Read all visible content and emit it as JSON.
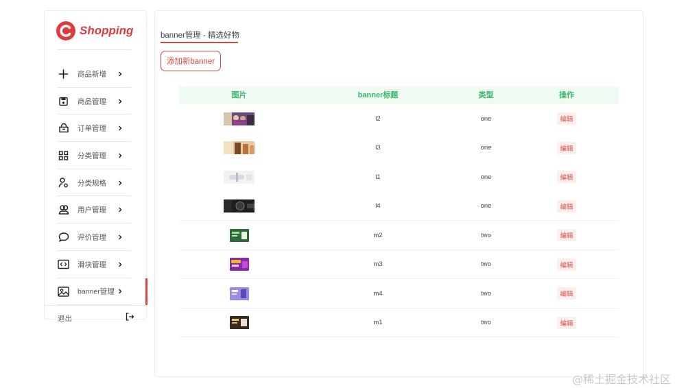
{
  "app": {
    "brand": "Shopping",
    "brand_mark": "C",
    "accent": "#e03a3e"
  },
  "sidebar": {
    "items": [
      {
        "label": "商品新增",
        "icon": "plus-icon",
        "active": false
      },
      {
        "label": "商品管理",
        "icon": "save-icon",
        "active": false
      },
      {
        "label": "订单管理",
        "icon": "shopping-bag-icon",
        "active": false
      },
      {
        "label": "分类管理",
        "icon": "grid-icon",
        "active": false
      },
      {
        "label": "分类规格",
        "icon": "user-location-icon",
        "active": false
      },
      {
        "label": "用户管理",
        "icon": "users-icon",
        "active": false
      },
      {
        "label": "评价管理",
        "icon": "comment-icon",
        "active": false
      },
      {
        "label": "滑块管理",
        "icon": "code-icon",
        "active": false
      },
      {
        "label": "banner管理",
        "icon": "image-icon",
        "active": true
      }
    ],
    "logout_label": "退出"
  },
  "main": {
    "title": "banner管理 - 精选好物",
    "add_button": "添加新banner",
    "table": {
      "headers": [
        "图片",
        "banner标题",
        "类型",
        "操作"
      ],
      "rows": [
        {
          "thumb": "purple-people",
          "title": "l2",
          "type": "one",
          "action": "编辑"
        },
        {
          "thumb": "warm-product",
          "title": "l3",
          "type": "one",
          "action": "编辑"
        },
        {
          "thumb": "white-device",
          "title": "l1",
          "type": "one",
          "action": "编辑"
        },
        {
          "thumb": "dark-watch",
          "title": "l4",
          "type": "one",
          "action": "编辑"
        },
        {
          "thumb": "green-promo",
          "title": "m2",
          "type": "two",
          "action": "编辑"
        },
        {
          "thumb": "magenta-promo",
          "title": "m3",
          "type": "two",
          "action": "编辑"
        },
        {
          "thumb": "lavender-promo",
          "title": "m4",
          "type": "two",
          "action": "编辑"
        },
        {
          "thumb": "brown-promo",
          "title": "m1",
          "type": "two",
          "action": "编辑"
        }
      ]
    }
  },
  "watermark": "@稀土掘金技术社区"
}
